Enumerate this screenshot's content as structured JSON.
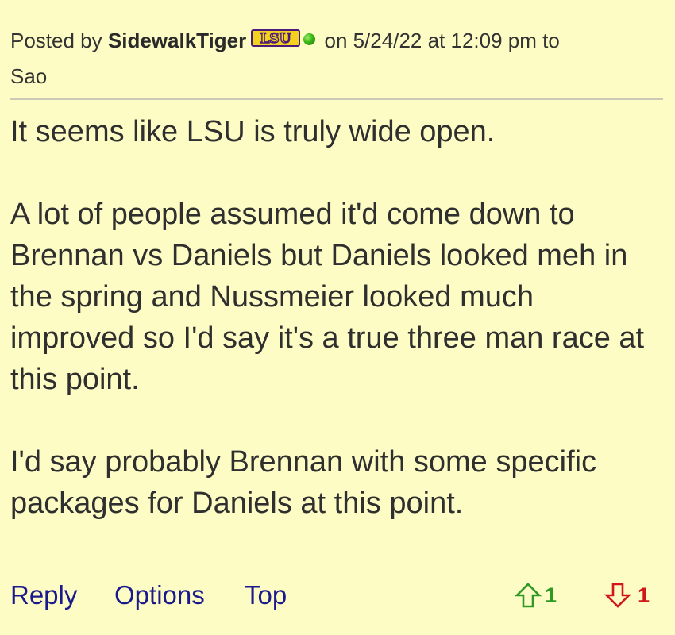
{
  "post": {
    "posted_by_label": "Posted by",
    "username": "SidewalkTiger",
    "team_badge": "LSU",
    "team_badge_colors": {
      "fill": "#f2d21e",
      "outline": "#4b1a7a"
    },
    "online_status_color": "#3bb515",
    "date_text": "on 5/24/22 at 12:09 pm to",
    "reply_to": "Sao",
    "paragraphs": [
      "It seems like LSU is truly wide open.",
      "A lot of people assumed it'd come down to Brennan vs Daniels but Daniels looked meh in the spring and Nussmeier looked much improved so I'd say it's a true three man race at this point.",
      "I'd say probably Brennan with some specific packages for Daniels at this point."
    ]
  },
  "actions": {
    "reply": "Reply",
    "options": "Options",
    "top": "Top"
  },
  "votes": {
    "up_icon": "arrow-up-outline-icon",
    "up_count": "1",
    "up_color": "#2e9a24",
    "down_icon": "arrow-down-outline-icon",
    "down_count": "1",
    "down_color": "#d01818"
  },
  "colors": {
    "background": "#fdfcc4",
    "link": "#1a1a8c"
  }
}
